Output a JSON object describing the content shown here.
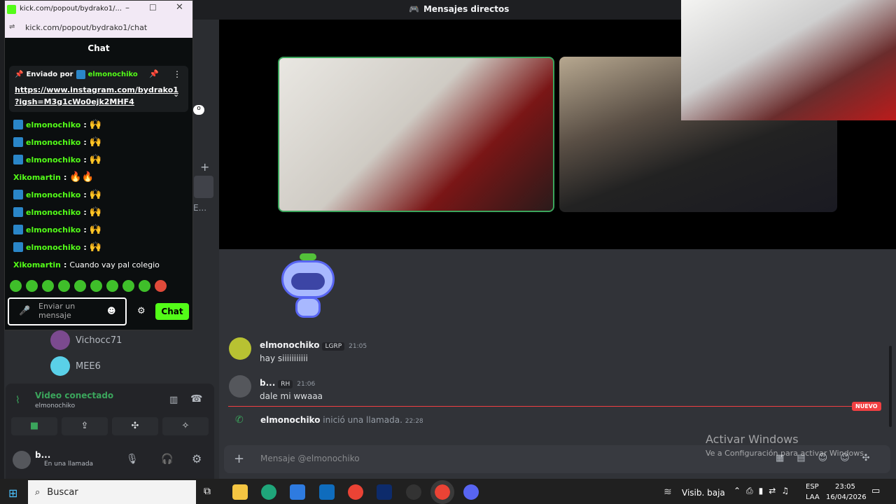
{
  "discord": {
    "top_title": "Mensajes directos",
    "members": [
      {
        "name": "Vichocc71",
        "color": "#7b4a8f"
      },
      {
        "name": "MEE6",
        "color": "#5ad0e8"
      }
    ],
    "voice": {
      "status": "Video conectado",
      "subtitle": "elmonochiko"
    },
    "user": {
      "name": "b...",
      "status": "En una llamada"
    },
    "messages": [
      {
        "name": "elmonochiko",
        "tag": "LGRP",
        "time": "21:05",
        "body": "hay siiiiiiiiiii"
      },
      {
        "name": "b...",
        "tag": "RH",
        "time": "21:06",
        "body": "dale mi wwaaa"
      }
    ],
    "call_event": {
      "name": "elmonochiko",
      "text": "inició una llamada.",
      "time": "22:28"
    },
    "new_badge": "NUEVO",
    "composer_placeholder": "Mensaje @elmonochiko",
    "activate_title": "Activar Windows",
    "activate_sub": "Ve a Configuración para activar Windows."
  },
  "kick": {
    "window_title": "kick.com/popout/bydrako1/...",
    "url": "kick.com/popout/bydrako1/chat",
    "chat_header": "Chat",
    "pinned_by_label": "Enviado por",
    "pinned_by_user": "elmonochiko",
    "pinned_link_1": "https://www.instagram.com/bydrako1",
    "pinned_link_2": "?igsh=M3g1cWo0ejk2MHF4",
    "lines": [
      {
        "user": "elmonochiko",
        "badge": true,
        "text": "",
        "emote": "🙌"
      },
      {
        "user": "elmonochiko",
        "badge": true,
        "text": "",
        "emote": "🙌"
      },
      {
        "user": "elmonochiko",
        "badge": true,
        "text": "",
        "emote": "🙌"
      },
      {
        "user": "Xikomartin",
        "badge": false,
        "text": "",
        "emote": "🔥🔥"
      },
      {
        "user": "elmonochiko",
        "badge": true,
        "text": "",
        "emote": "🙌"
      },
      {
        "user": "elmonochiko",
        "badge": true,
        "text": "",
        "emote": "🙌"
      },
      {
        "user": "elmonochiko",
        "badge": true,
        "text": "",
        "emote": "🙌"
      },
      {
        "user": "elmonochiko",
        "badge": true,
        "text": "",
        "emote": "🙌"
      },
      {
        "user": "Xikomartin",
        "badge": false,
        "text": "Cuando vay pal colegio",
        "emote": ""
      }
    ],
    "input_placeholder": "Enviar un mensaje",
    "chat_button": "Chat"
  },
  "taskbar": {
    "search_label": "Buscar",
    "weather": "Visib. baja",
    "lang_1": "ESP",
    "lang_2": "LAA",
    "time": "23:05",
    "date": "16/04/2026"
  }
}
